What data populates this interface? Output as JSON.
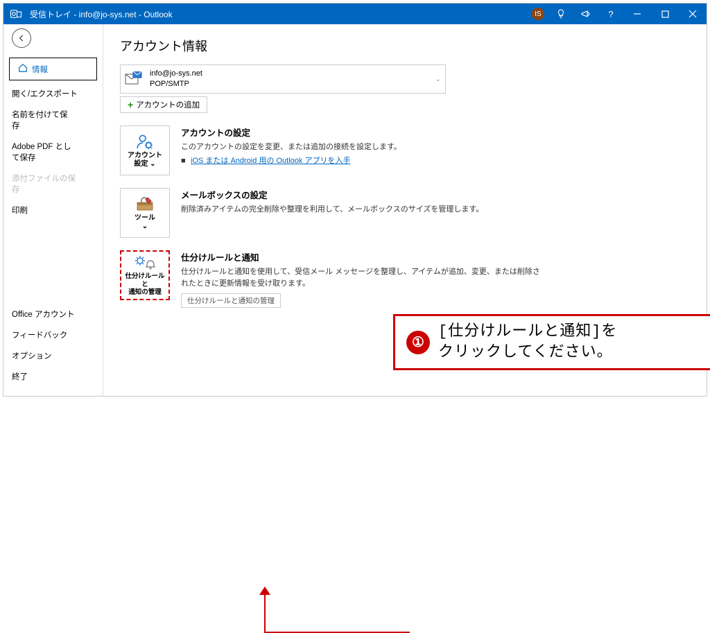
{
  "titlebar": {
    "title": "受信トレイ - info@jo-sys.net  -  Outlook",
    "avatar_initials": "IS"
  },
  "sidebar": {
    "info": "情報",
    "open_export": "開く/エクスポート",
    "save_as": "名前を付けて保\n存",
    "adobe_pdf": "Adobe PDF とし\nて保存",
    "save_attach": "添付ファイルの保\n存",
    "print": "印刷",
    "office_account": "Office アカウント",
    "feedback": "フィードバック",
    "options": "オプション",
    "exit": "終了"
  },
  "main": {
    "heading": "アカウント情報",
    "account": {
      "email": "info@jo-sys.net",
      "type": "POP/SMTP"
    },
    "add_account": "アカウントの追加",
    "dropdown_arrow": "⌄",
    "settings_block": {
      "button": "アカウント\n設定 ⌄",
      "title": "アカウントの設定",
      "desc": "このアカウントの設定を変更、または追加の接続を設定します。",
      "link": "iOS または Android 用の Outlook アプリを入手"
    },
    "mailbox_block": {
      "button": "ツール\n⌄",
      "title": "メールボックスの設定",
      "desc": "削除済みアイテムの完全削除や整理を利用して、メールボックスのサイズを管理します。"
    },
    "rules_block": {
      "button": "仕分けルールと\n通知の管理",
      "title": "仕分けルールと通知",
      "desc": "仕分けルールと通知を使用して、受信メール メッセージを整理し、アイテムが追加、変更、または削除されたときに更新情報を受け取ります。",
      "sub_button": "仕分けルールと通知の管理"
    }
  },
  "callout": {
    "num": "①",
    "text": "[仕分けルールと通知]を\nクリックしてください。"
  }
}
